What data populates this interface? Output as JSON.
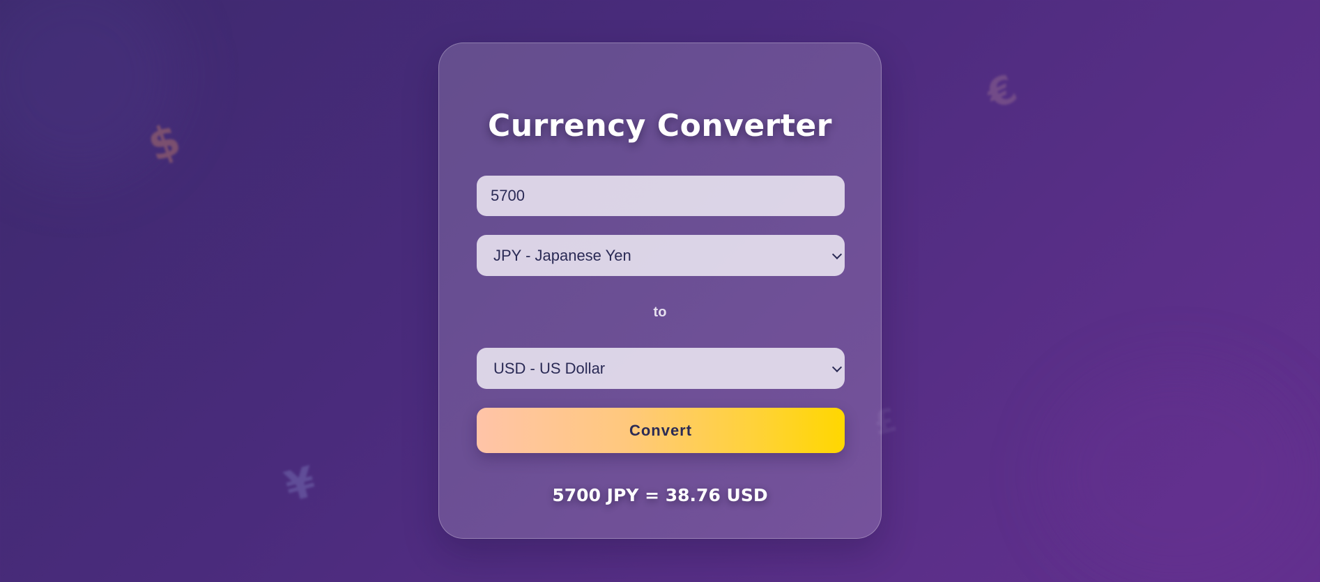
{
  "app": {
    "title": "Currency Converter"
  },
  "form": {
    "amount_value": "5700",
    "from_currency": "JPY - Japanese Yen",
    "separator": "to",
    "to_currency": "USD - US Dollar",
    "convert_label": "Convert"
  },
  "result": {
    "text": "5700 JPY = 38.76 USD"
  },
  "background": {
    "symbols": [
      "$",
      "€",
      "¥",
      "£"
    ]
  },
  "colors": {
    "background_start": "#3d2a6e",
    "background_end": "#63308f",
    "button_gradient_start": "#ffc4a8",
    "button_gradient_end": "#ffd700",
    "text_dark": "#2a2a55"
  },
  "icons": {
    "select_arrow": "chevron-down-icon"
  }
}
